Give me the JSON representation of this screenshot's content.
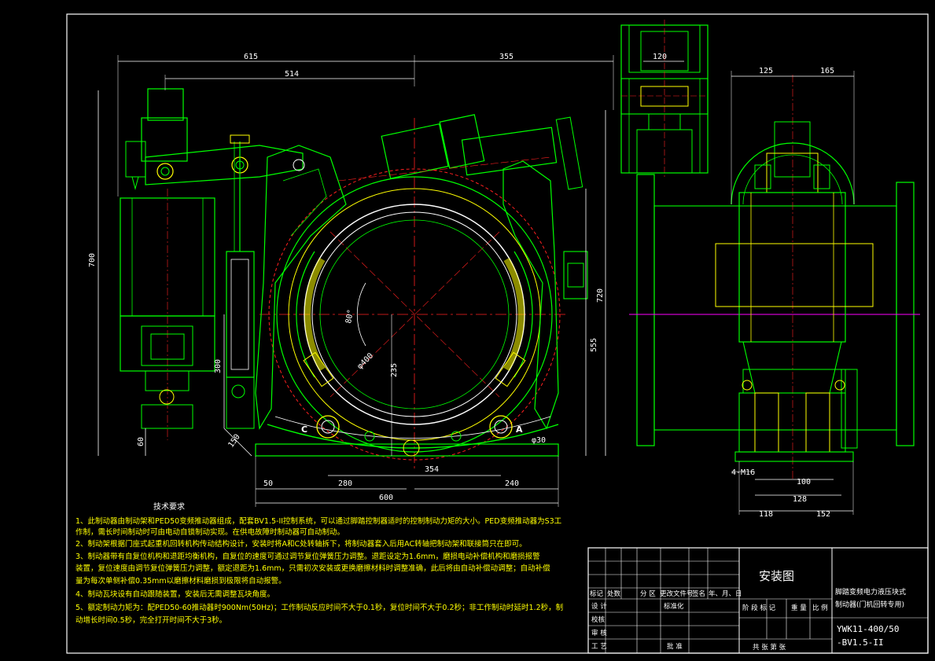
{
  "drawing": {
    "main_view_dims": {
      "top_615": "615",
      "top_355": "355",
      "top_514": "514",
      "left_700": "700",
      "left_300": "300",
      "left_60": "60",
      "left_150": "150",
      "right_720": "720",
      "right_555": "555",
      "center_235": "235",
      "bottom_50": "50",
      "bottom_280": "280",
      "bottom_354": "354",
      "bottom_240": "240",
      "bottom_600": "600",
      "angle_80": "80°",
      "diameter_400": "φ400",
      "diameter_30": "φ30",
      "label_c": "C",
      "label_a": "A"
    },
    "top_view_dims": {
      "width_120": "120"
    },
    "side_view_dims": {
      "top_125": "125",
      "top_165": "165",
      "bolts": "4-M16",
      "dim_100": "100",
      "dim_128": "128",
      "dim_118": "118",
      "dim_152": "152"
    }
  },
  "notes": {
    "title": "技术要求",
    "lines": [
      "1、此制动器由制动架和PED50变频推动器组成，配套BV1.5-II控制系统，可以通过脚踏控制器适时的控制制动力矩的大小。PED变频推动器为S3工",
      "作制，需长时间制动时可由电动自锁制动实现。在供电故障时制动器可自动制动。",
      "2、制动架根据门座式起重机回转机构传动结构设计，安装时将A和C处转轴拆下，将制动器套入后用AC转轴把制动架和联接筒只在即可。",
      "3、制动器带有自复位机构和退距均衡机构，自复位的速度可通过调节复位弹簧压力调整。退距设定为1.6mm，磨损电动补偿机构和磨损报警",
      "装置，复位速度由调节复位弹簧压力调整，额定退距为1.6mm，只需初次安装或更换磨擦材料时调整准确，此后将由自动补偿动调整；自动补偿",
      "量为每次单侧补偿0.35mm以磨擦材料磨损到极限将自动报警。",
      "4、制动瓦块设有自动跟随装置，安装后无需调整瓦块角度。",
      "5、额定制动力矩为：配PED50-60推动器时900Nm(50Hz)；工作制动反应时间不大于0.1秒，复位时间不大于0.2秒；非工作制动时延时1.2秒，制",
      "动增长时间0.5秒，完全打开时间不大于3秒。"
    ]
  },
  "title_block": {
    "drawing_title": "安装图",
    "product_name_1": "脚踏变频电力液压块式",
    "product_name_2": "制动器(门机回转专用)",
    "code_1": "YWK11-400/50",
    "code_2": "-BV1.5-II",
    "rev_headers": [
      "标记",
      "处数",
      "分 区",
      "更改文件号",
      "签名",
      "年、月、日"
    ],
    "row_design": "设 计",
    "row_std": "标准化",
    "row_check": "校核",
    "row_review": "审 核",
    "row_process": "工 艺",
    "row_approve": "批 准",
    "stage_headers": [
      "阶 段 标 记",
      "重 量",
      "比 例"
    ],
    "sheet_info": "共   张   第   张"
  },
  "colors": {
    "outline": "#00ff00",
    "white": "#ffffff",
    "yellow": "#ffff00",
    "red": "#ff2020",
    "magenta": "#ff00ff",
    "cyan": "#00ffff",
    "blue": "#3060ff"
  }
}
